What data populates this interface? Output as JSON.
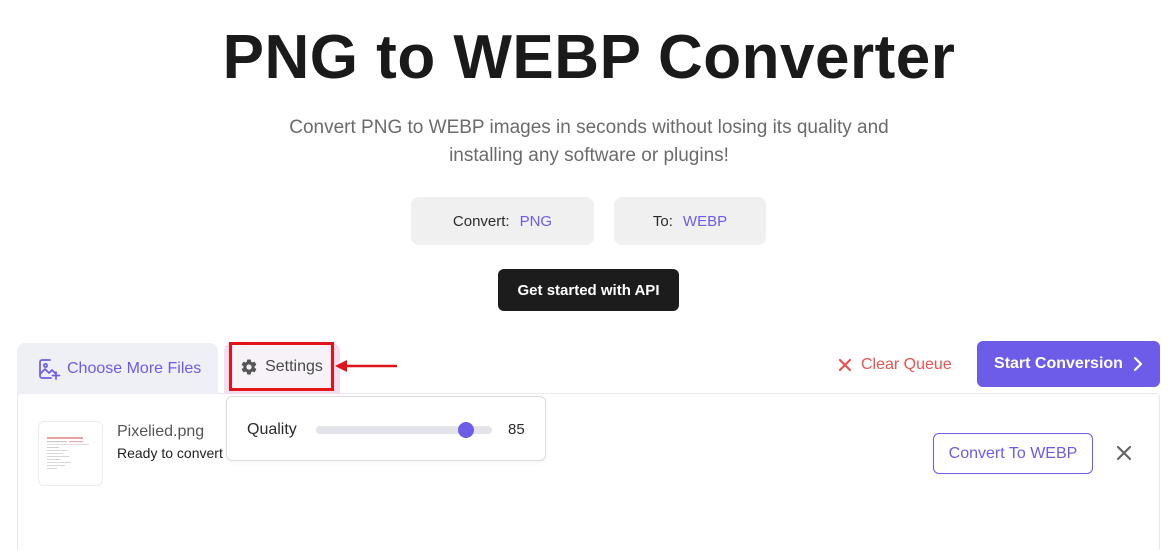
{
  "header": {
    "title": "PNG to WEBP Converter",
    "subtitle": "Convert PNG to WEBP images in seconds without losing its quality and installing any software or plugins!"
  },
  "formats": {
    "convert_label": "Convert:",
    "convert_value": "PNG",
    "to_label": "To:",
    "to_value": "WEBP"
  },
  "api_button": "Get started with API",
  "toolbar": {
    "choose_files": "Choose More Files",
    "settings": "Settings",
    "clear_queue": "Clear Queue",
    "start_conversion": "Start Conversion"
  },
  "settings_popover": {
    "quality_label": "Quality",
    "quality_value": 85,
    "quality_max": 100
  },
  "file": {
    "name": "Pixelied.png",
    "status": "Ready to convert",
    "convert_button": "Convert To WEBP"
  },
  "colors": {
    "accent": "#6c5ce7",
    "danger": "#e55353",
    "highlight": "#e1141b"
  }
}
